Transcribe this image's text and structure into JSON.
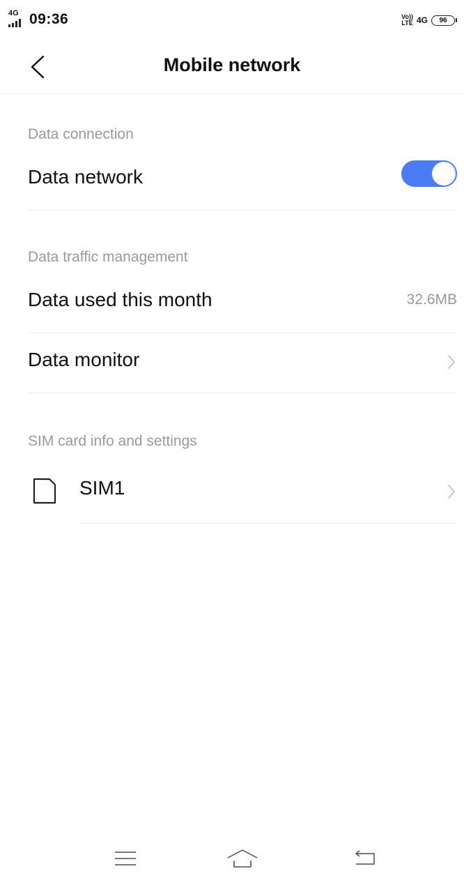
{
  "status_bar": {
    "network_type": "4G",
    "time": "09:36",
    "volte_top": "Vo))",
    "volte_bottom": "LTE",
    "network_right": "4G",
    "battery_level": "96"
  },
  "header": {
    "title": "Mobile network",
    "back_icon": "chevron-left-icon"
  },
  "sections": {
    "data_connection": {
      "label": "Data connection",
      "data_network": {
        "label": "Data network",
        "enabled": true,
        "toggle_color": "#4a7cf6"
      }
    },
    "traffic": {
      "label": "Data traffic management",
      "data_used": {
        "label": "Data used this month",
        "value": "32.6MB"
      },
      "data_monitor": {
        "label": "Data monitor",
        "icon": "chevron-right-icon"
      }
    },
    "sim": {
      "label": "SIM card info and settings",
      "sim1": {
        "label": "SIM1",
        "icon": "sim-card-icon"
      }
    }
  },
  "nav_bar": {
    "menu_icon": "menu-icon",
    "home_icon": "home-icon",
    "back_icon": "back-arrow-icon"
  }
}
